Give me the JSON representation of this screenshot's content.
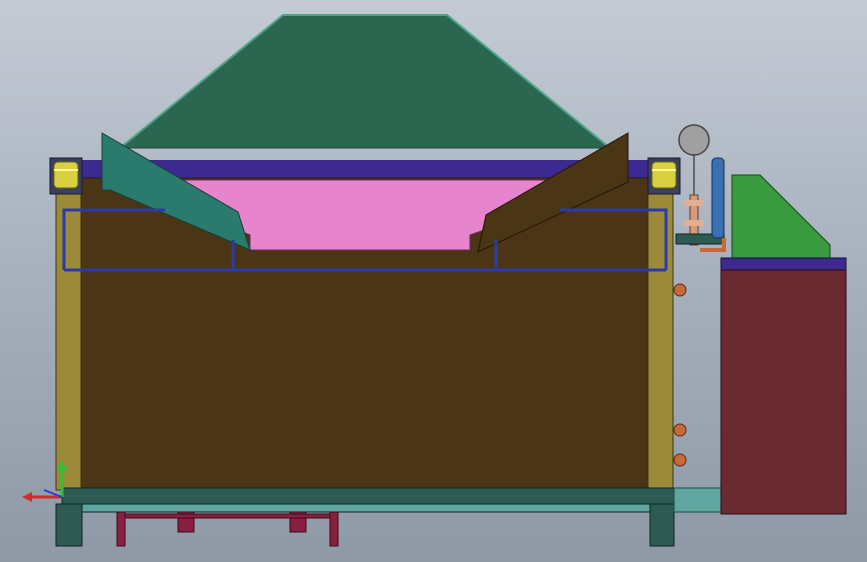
{
  "viewport": {
    "kind": "cad-3d-model-view",
    "background_gradient": [
      "#c4cbd5",
      "#8f99a6"
    ]
  },
  "model": {
    "parts": [
      {
        "name": "hood",
        "color": "#2a6650"
      },
      {
        "name": "hood-trim",
        "color": "#3f8a72"
      },
      {
        "name": "basin",
        "color": "#e684cc"
      },
      {
        "name": "left-chute",
        "color": "#2a7a6e"
      },
      {
        "name": "right-chute",
        "color": "#4a3515"
      },
      {
        "name": "tank-body",
        "color": "#4b3516"
      },
      {
        "name": "tank-frame",
        "color": "#9a8a3a"
      },
      {
        "name": "guard-rail",
        "color": "#2a3aa8"
      },
      {
        "name": "corner-roller",
        "color": "#d8d040"
      },
      {
        "name": "base-skid",
        "color": "#2d5b53"
      },
      {
        "name": "under-support",
        "color": "#8a2040"
      },
      {
        "name": "pressure-gauge",
        "color": "#a0a0a0"
      },
      {
        "name": "filter-cylinder",
        "color": "#3a6fb0"
      },
      {
        "name": "valve-stack",
        "color": "#d49a7a"
      },
      {
        "name": "control-cabinet",
        "color": "#6b2a32"
      },
      {
        "name": "cabinet-top",
        "color": "#3c2a90"
      },
      {
        "name": "cabinet-housing",
        "color": "#3a9a3e"
      },
      {
        "name": "outlet-duct",
        "color": "#5fa6a0"
      }
    ]
  },
  "triad": {
    "axes": [
      {
        "name": "y-axis",
        "color": "#2fbf3a"
      },
      {
        "name": "x-axis",
        "color": "#d42a2a"
      },
      {
        "name": "z-axis",
        "color": "#2a3ad4"
      }
    ]
  }
}
